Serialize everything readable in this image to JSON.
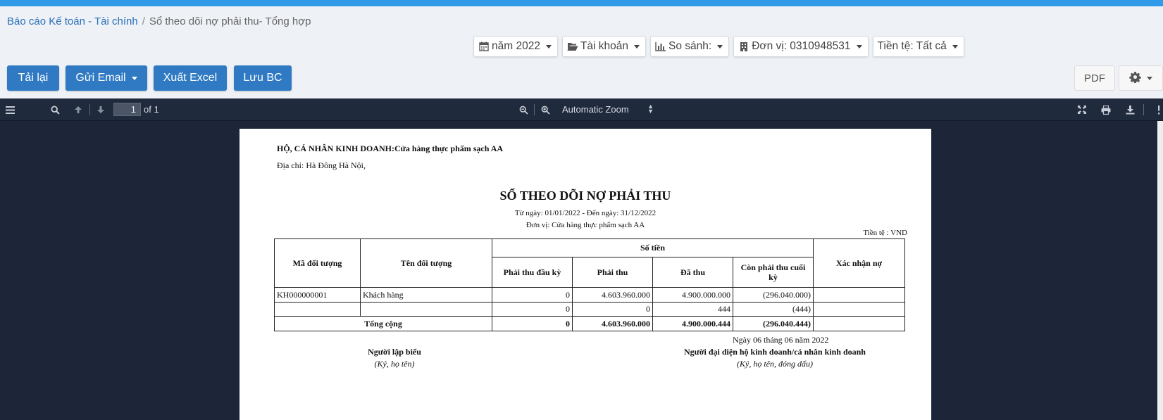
{
  "breadcrumb": {
    "parent": "Báo cáo Kế toán - Tài chính",
    "separator": "/",
    "current": "Sổ theo dõi nợ phải thu- Tổng hợp"
  },
  "filters": {
    "year": "năm 2022",
    "account": "Tài khoản",
    "compare": "So sánh:",
    "unit": "Đơn vị: 0310948531",
    "currency": "Tiền tệ: Tất cả"
  },
  "actions": {
    "reload": "Tải lại",
    "email": "Gửi Email",
    "excel": "Xuất Excel",
    "save": "Lưu BC",
    "pdf": "PDF"
  },
  "viewer": {
    "page_current": "1",
    "page_of": "of 1",
    "zoom": "Automatic Zoom"
  },
  "report": {
    "business": "HỘ, CÁ NHÂN KINH DOANH:Cửa hàng thực phẩm sạch AA",
    "address": "Địa chỉ: Hà Đông Hà Nội,",
    "title": "SỔ THEO DÕI NỢ PHẢI THU",
    "period": "Từ ngày: 01/01/2022 - Đến ngày: 31/12/2022",
    "unit": "Đơn vị: Cửa hàng thực phẩm sạch AA",
    "currency": "Tiền tệ : VND",
    "headers": {
      "code": "Mã đối tượng",
      "name": "Tên đối tượng",
      "amount": "Số tiền",
      "opening": "Phải thu đầu kỳ",
      "receivable": "Phải thu",
      "collected": "Đã thu",
      "closing": "Còn phải thu cuối kỳ",
      "confirm": "Xác nhận nợ"
    },
    "rows": [
      {
        "code": "KH000000001",
        "name": "Khách hàng",
        "opening": "0",
        "receivable": "4.603.960.000",
        "collected": "4.900.000.000",
        "closing": "(296.040.000)",
        "confirm": ""
      },
      {
        "code": "",
        "name": "",
        "opening": "0",
        "receivable": "0",
        "collected": "444",
        "closing": "(444)",
        "confirm": ""
      }
    ],
    "total": {
      "label": "Tổng cộng",
      "opening": "0",
      "receivable": "4.603.960.000",
      "collected": "4.900.000.444",
      "closing": "(296.040.444)",
      "confirm": ""
    },
    "date_line": "Ngày 06 tháng 06 năm 2022",
    "preparer": {
      "title": "Người lập biểu",
      "sub": "(Ký, họ tên)"
    },
    "representative": {
      "title": "Người đại diện hộ kinh doanh/cá nhân kinh doanh",
      "sub": "(Ký, họ tên, đóng dấu)"
    }
  }
}
